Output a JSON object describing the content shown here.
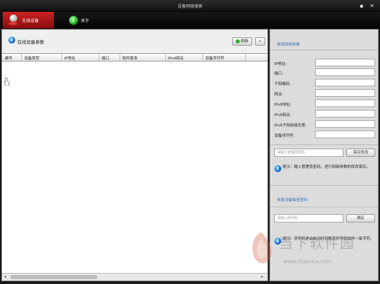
{
  "window": {
    "title": "设备网络搜索",
    "minimize_glyph": "▪",
    "close_glyph": "✕"
  },
  "tabs": [
    {
      "label": "在线设备",
      "icon": "network-device-icon"
    },
    {
      "label": "关于",
      "icon": "info-icon"
    }
  ],
  "left": {
    "title": "在线设备参数",
    "refresh_label": "刷新",
    "more_label": "»",
    "columns": [
      "编号",
      "设备类型",
      "IP地址",
      "端口",
      "软件版本",
      "IPv4网关",
      "设备序列号"
    ]
  },
  "right": {
    "params_title": "修改网络参数",
    "fields": [
      "IP地址:",
      "端口:",
      "子网掩码:",
      "网关:",
      "IPv6地址:",
      "IPv6网关:",
      "IPv6子网前缀长度:",
      "设备序列号:"
    ],
    "password_placeholder": "请输入管理员密码",
    "save_label": "保存修改",
    "tip1": "提示：输入管理员密码，进行网络参数的修改保存。",
    "restore_title": "恢复设备缺省密码",
    "serial_placeholder": "请输入序列码",
    "confirm_label": "确定",
    "tip2": "提示：序列码是由启动时间和序列号组成的一串字符。"
  },
  "watermark": {
    "text_cn": "当下软件园",
    "url": "www.downxia.com"
  },
  "colors": {
    "active_tab": "#c22222",
    "link_blue": "#3b6cb4"
  }
}
